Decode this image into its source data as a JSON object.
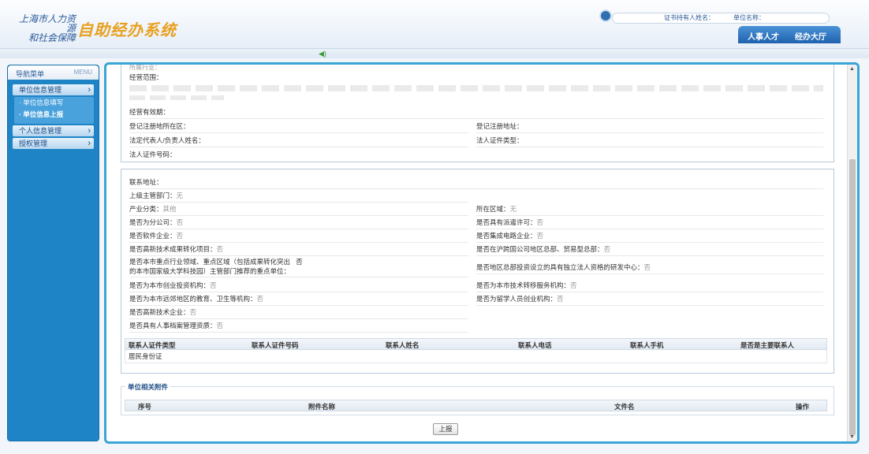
{
  "header": {
    "logo_line1": "上海市人力资源",
    "logo_line2": "和社会保障",
    "logo_title": "自助经办系统",
    "cert_holder_label": "证书持有人姓名：",
    "unit_name_label": "单位名称：",
    "tabs": [
      {
        "label": "人事人才"
      },
      {
        "label": "经办大厅"
      }
    ]
  },
  "sidebar": {
    "title": "导航菜单",
    "title_en": "MENU",
    "items": [
      {
        "label": "单位信息管理",
        "children": [
          {
            "label": "单位信息填写"
          },
          {
            "label": "单位信息上报"
          }
        ]
      },
      {
        "label": "个人信息管理"
      },
      {
        "label": "授权管理"
      }
    ]
  },
  "basic_panel": {
    "top_cut": "所属行业：",
    "business_scope_label": "经营范围：",
    "business_period_label": "经营有效期：",
    "reg_area_label": "登记注册地所在区：",
    "reg_address_label": "登记注册地址：",
    "legal_rep_label": "法定代表人/负责人姓名：",
    "legal_id_type_label": "法人证件类型：",
    "legal_id_no_label": "法人证件号码："
  },
  "contact_panel": {
    "rows": [
      {
        "left": "联系地址：",
        "left_val": ""
      },
      {
        "left": "上级主管部门：",
        "left_val": "无"
      },
      {
        "left": "产业分类：",
        "left_val": "其他",
        "right": "所在区域：",
        "right_val": "无"
      },
      {
        "left": "是否为分公司：",
        "left_val": "否",
        "right": "是否具有派遣许可：",
        "right_val": "否"
      },
      {
        "left": "是否软件企业：",
        "left_val": "否",
        "right": "是否集成电路企业：",
        "right_val": "否"
      },
      {
        "left": "是否高新技术成果转化项目：",
        "left_val": "否",
        "right": "是否在沪跨国公司地区总部、贸易型总部：",
        "right_val": "否"
      },
      {
        "left": "是否本市重点行业领域、重点区域（包括成果转化突出",
        "left_val": "否",
        "left2": "的本市国家级大学科技园）主管部门推荐的重点单位：",
        "right": "是否地区总部投资设立的具有独立法人资格的研发中心：",
        "right_val": "否"
      },
      {
        "left": "是否为本市创业投资机构：",
        "left_val": "否",
        "right": "是否为本市技术转移服务机构：",
        "right_val": "否"
      },
      {
        "left": "是否为本市远郊地区的教育、卫生等机构：",
        "left_val": "否",
        "right": "是否为留学人员创业机构：",
        "right_val": "否"
      },
      {
        "left": "是否高新技术企业：",
        "left_val": "否"
      },
      {
        "left": "是否具有人事档案管理资质：",
        "left_val": "否"
      }
    ],
    "contact_table": {
      "headers": [
        "联系人证件类型",
        "联系人证件号码",
        "联系人姓名",
        "联系人电话",
        "联系人手机",
        "是否是主要联系人"
      ],
      "rows": [
        [
          "居民身份证",
          "",
          "",
          "",
          "",
          ""
        ]
      ]
    }
  },
  "attachments": {
    "legend": "单位相关附件",
    "headers": [
      "序号",
      "附件名称",
      "文件名",
      "操作"
    ]
  },
  "submit_label": "上报"
}
